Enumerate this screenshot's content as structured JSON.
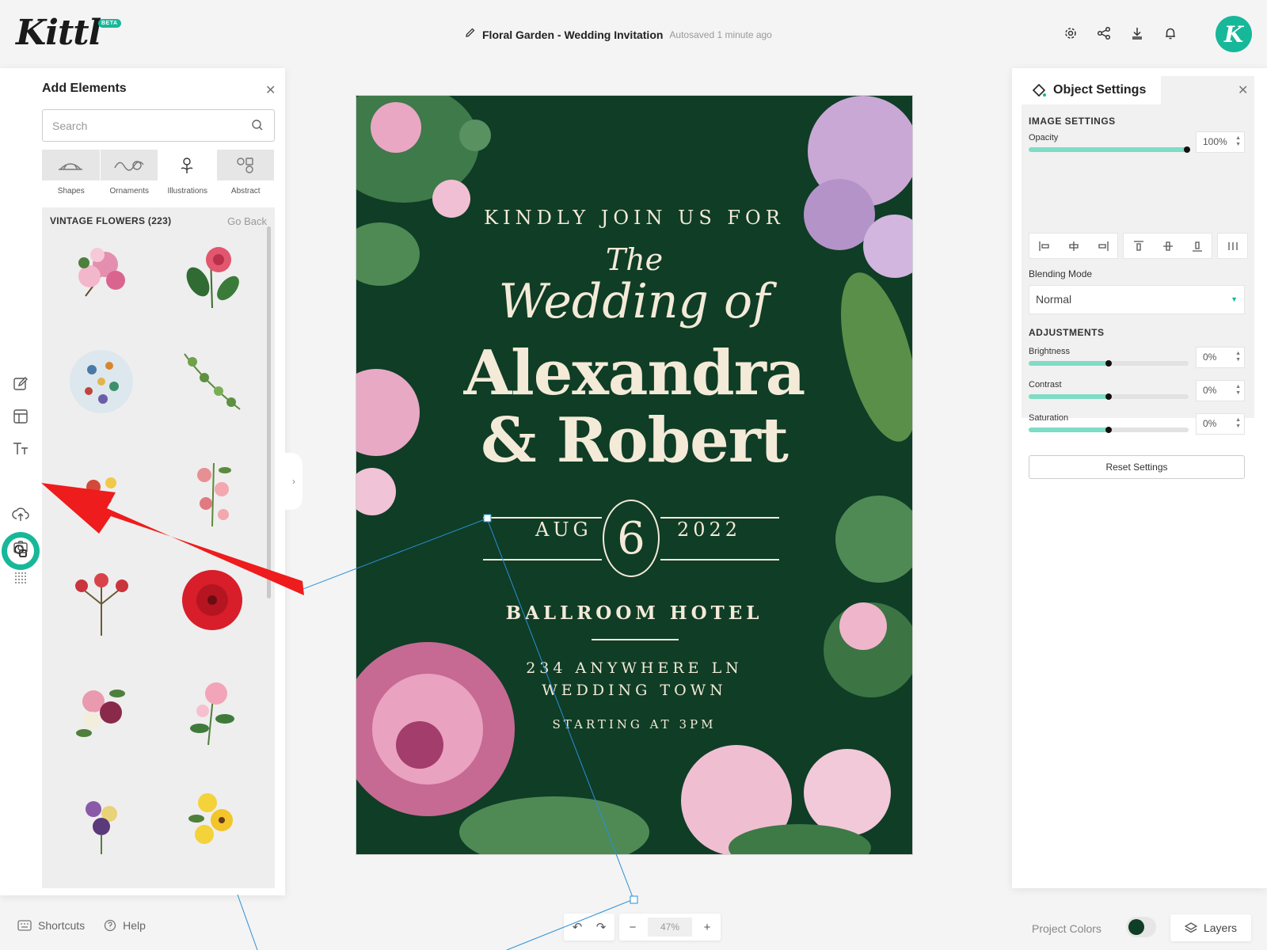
{
  "header": {
    "logo": "Kittl",
    "beta_badge": "BETA",
    "document_title": "Floral Garden - Wedding Invitation",
    "autosave_status": "Autosaved 1 minute ago",
    "icons": [
      "gear-icon",
      "share-icon",
      "download-icon",
      "bell-icon"
    ],
    "avatar_letter": "K"
  },
  "rail": {
    "icons": [
      "edit-icon",
      "template-icon",
      "text-icon",
      "elements-icon",
      "upload-icon",
      "camera-icon",
      "grid-dots-icon"
    ],
    "active": "elements-icon"
  },
  "elements_panel": {
    "title": "Add Elements",
    "search_placeholder": "Search",
    "categories": [
      {
        "label": "Shapes"
      },
      {
        "label": "Ornaments"
      },
      {
        "label": "Illustrations",
        "active": true
      },
      {
        "label": "Abstract"
      }
    ],
    "section_title": "VINTAGE FLOWERS (223)",
    "go_back": "Go Back"
  },
  "invitation": {
    "line1": "KINDLY JOIN US FOR",
    "line2": "The",
    "line3": "Wedding of",
    "name1": "Alexandra",
    "name2": "& Robert",
    "month": "AUG",
    "day": "6",
    "year": "2022",
    "venue": "BALLROOM HOTEL",
    "address1": "234 ANYWHERE LN",
    "address2": "WEDDING TOWN",
    "time": "STARTING AT 3PM",
    "background_color": "#0f3d26"
  },
  "settings_panel": {
    "title": "Object Settings",
    "image_settings_heading": "IMAGE SETTINGS",
    "opacity_label": "Opacity",
    "opacity_value": "100%",
    "opacity_level": 1.0,
    "blending_label": "Blending Mode",
    "blending_value": "Normal",
    "adjustments_heading": "ADJUSTMENTS",
    "brightness_label": "Brightness",
    "brightness_value": "0%",
    "contrast_label": "Contrast",
    "contrast_value": "0%",
    "saturation_label": "Saturation",
    "saturation_value": "0%",
    "adjustment_level": 0.5,
    "reset_label": "Reset Settings"
  },
  "bottom_bar": {
    "shortcuts": "Shortcuts",
    "help": "Help",
    "zoom": "47%",
    "project_colors": "Project Colors",
    "layers": "Layers"
  },
  "colors": {
    "accent": "#16b899",
    "annotation_arrow": "#ee1c1c",
    "selection_line": "#2a8fd6"
  }
}
